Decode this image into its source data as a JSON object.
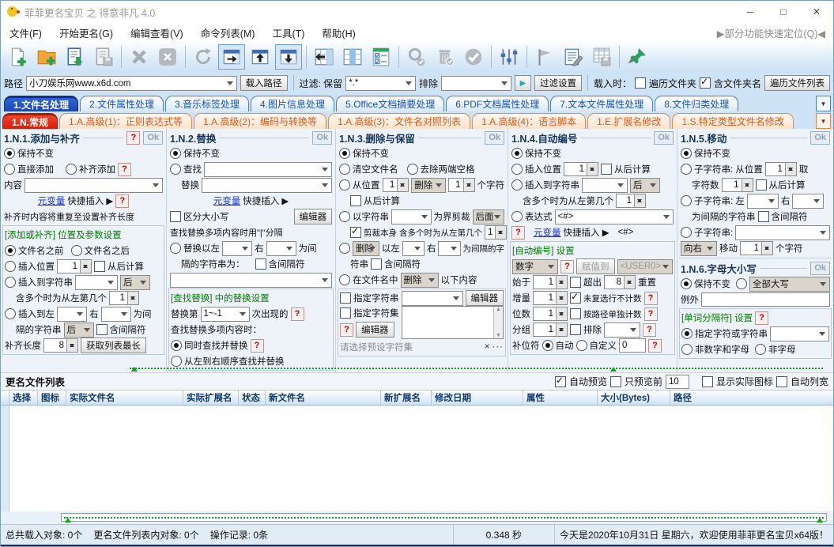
{
  "window": {
    "title": "菲菲更名宝贝 之 得意非凡 4.0",
    "minimize": "─",
    "maximize": "□",
    "close": "✕"
  },
  "menu": {
    "items": [
      "文件(F)",
      "开始更名(G)",
      "编辑查看(V)",
      "命令列表(M)",
      "工具(T)",
      "帮助(H)"
    ],
    "quick_locate": "▶部分功能快速定位(Q)◀"
  },
  "toolbar": {
    "icons": [
      "new-list",
      "add-folder",
      "import-list",
      "save-list",
      "remove",
      "remove-all",
      "refresh",
      "dock-right",
      "dock-top",
      "dock-bottom",
      "move-column-left",
      "column-view",
      "check-list",
      "preview-check",
      "delete-checked",
      "apply-check",
      "filter-sliders",
      "flag",
      "edit-log",
      "export-table",
      "pin"
    ]
  },
  "pathbar": {
    "path_label": "路径",
    "path_value": "小刀娱乐网www.x6d.com",
    "load_button": "载入路径",
    "filter_label": "过滤: 保留",
    "keep_value": "*.*",
    "exclude_label": "排除",
    "play": "▶",
    "filter_button": "过滤设置",
    "onload_label": "载入时：",
    "traverse_folders": "遍历文件夹",
    "include_folder_name": "含文件夹名",
    "traverse_list_button": "遍历文件列表"
  },
  "tabs": {
    "main": [
      "1.文件名处理",
      "2.文件属性处理",
      "3.音乐标签处理",
      "4.图片信息处理",
      "5.Office文档摘要处理",
      "6.PDF文档属性处理",
      "7.文本文件属性处理",
      "8.文件归类处理"
    ],
    "sub": [
      "1.N.常规",
      "1.A.高级(1)：正则表达式等",
      "1.A.高级(2)：编码与转换等",
      "1.A.高级(3)：文件名对照列表",
      "1.A.高级(4)：语言脚本",
      "1.E.扩展名修改",
      "1.S.特定类型文件名修改"
    ],
    "dropdown": "▼"
  },
  "p1": {
    "title": "1.N.1.添加与补齐",
    "help": "?",
    "ok": "Ok",
    "keep": "保持不变",
    "direct": "直接添加",
    "pad": "补齐添加",
    "content": "内容",
    "var_link": "元变量",
    "var_rest": "快捷插入 ▶",
    "note": "补齐时内容将重复至设置补齐长度",
    "group": "[添加或补齐] 位置及参数设置",
    "before": "文件名之前",
    "after": "文件名之后",
    "insert_pos": "插入位置",
    "pos_val": "1",
    "from_end": "从后计算",
    "insert_str": "插入到字符串",
    "pos_after": "后",
    "multi": "含多个时为从左第几个",
    "multi_val": "1",
    "between_l": "插入到左",
    "between_r": "右",
    "between_sfx": "为间",
    "sep_str": "隔的字符串",
    "sep_after": "后",
    "inc_sep": "含间隔符",
    "pad_len": "补齐长度",
    "pad_val": "8",
    "get_longest": "获取列表最长"
  },
  "p2": {
    "title": "1.N.2.替换",
    "ok": "Ok",
    "keep": "保持不变",
    "find": "查找",
    "replace": "替换",
    "var_link": "元变量",
    "var_rest": "快捷插入 ▶",
    "case": "区分大小写",
    "editor": "编辑器",
    "note": "查找替换多项内容时用\"|\"分隔",
    "between": "替换以左",
    "right": "右",
    "between_sfx": "为间",
    "sep_line": "隔的字符串为：",
    "inc_sep": "含间隔符",
    "group": "[查找替换] 中的替换设置",
    "nth": "替换第",
    "nth_val": "1~-1",
    "nth_sfx": "次出现的",
    "help": "?",
    "multi_note": "查找替换多项内容时：",
    "simul": "同时查找并替换",
    "l2r": "从左到右顺序查找并替换"
  },
  "p3": {
    "title": "1.N.3.删除与保留",
    "ok": "Ok",
    "keep": "保持不变",
    "clear": "清空文件名",
    "trim": "去除两端空格",
    "from_pos": "从位置",
    "v1": "1",
    "del1": "删除",
    "v2": "1",
    "chars": "个字符",
    "from_end": "从后计算",
    "by_str": "以字符串",
    "cut": "为界剪裁",
    "side": "后面",
    "cut_self": "剪裁本身",
    "multi": "含多个时为从左第几个",
    "multi_val": "1",
    "del2": "删除",
    "between_l": "以左",
    "between_r": "右",
    "between_sfx": "为间隔的字",
    "sep_line": "符串",
    "inc_sep": "含间隔符",
    "in_name": "在文件名中",
    "del3": "删除",
    "following": "以下内容",
    "spec_str": "指定字符串",
    "editor1": "编辑器",
    "spec_set": "指定字符集",
    "help": "?",
    "editor2": "编辑器",
    "preset": "请选择预设字符集",
    "close": "×",
    "more": "···"
  },
  "p4": {
    "title": "1.N.4.自动编号",
    "ok": "Ok",
    "keep": "保持不变",
    "insert_pos": "插入位置",
    "pos_val": "1",
    "from_end": "从后计算",
    "insert_str": "插入到字符串",
    "pos_after": "后",
    "multi": "含多个时为从左第几个",
    "multi_val": "1",
    "expr": "表达式",
    "expr_val": "<#>",
    "help": "?",
    "var_link": "元变量",
    "var_rest": "快捷插入 ▶",
    "var_tag": "<#>",
    "group": "[自动编号] 设置",
    "type_val": "数字",
    "assign": "赋值到",
    "assign_val": "<USER0>",
    "start": "始于",
    "start_val": "1",
    "over": "超出",
    "over_val": "8",
    "reset": "重置",
    "inc": "增量",
    "inc_val": "1",
    "skip": "未复选行不计数",
    "digits": "位数",
    "digits_val": "1",
    "per_path": "按路径单独计数",
    "grp": "分组",
    "grp_val": "1",
    "exclude": "排除",
    "pad_lbl": "补位符",
    "auto": "自动",
    "custom": "自定义",
    "custom_val": "0"
  },
  "p5": {
    "title": "1.N.5.移动",
    "ok": "Ok",
    "keep": "保持不变",
    "sub1": "子字符串: 从位置",
    "v1": "1",
    "take": "取",
    "chars": "字符数",
    "v2": "1",
    "from_end": "从后计算",
    "sub2": "子字符串: 左",
    "right": "右",
    "sep": "为间隔的字符串",
    "inc_sep": "含间隔符",
    "sub3": "子字符串:",
    "dir": "向右",
    "move": "移动",
    "v3": "1",
    "chars2": "个字符"
  },
  "p6": {
    "title": "1.N.6.字母大小写",
    "ok": "Ok",
    "keep": "保持不变",
    "case_val": "全部大写",
    "except": "例外",
    "group": "[单词分隔符] 设置",
    "help": "?",
    "spec": "指定字符或字符串",
    "non_alnum": "非数字和字母",
    "non_alpha": "非字母"
  },
  "list": {
    "title": "更名文件列表",
    "auto_preview": "自动预览",
    "preview_first": "只预览前",
    "preview_n": "10",
    "real_icons": "显示实际图标",
    "auto_width": "自动列宽",
    "headers": [
      "选择",
      "图标",
      "实际文件名",
      "实际扩展名",
      "状态",
      "新文件名",
      "新扩展名",
      "修改日期",
      "属性",
      "大小(Bytes)",
      "路径"
    ]
  },
  "status": {
    "left1": "总共载入对象: 0个",
    "left2": "更名文件列表内对象: 0个",
    "left3": "操作记录: 0条",
    "time": "0.348 秒",
    "right": "今天是2020年10月31日 星期六，欢迎使用菲菲更名宝贝x64版！"
  }
}
